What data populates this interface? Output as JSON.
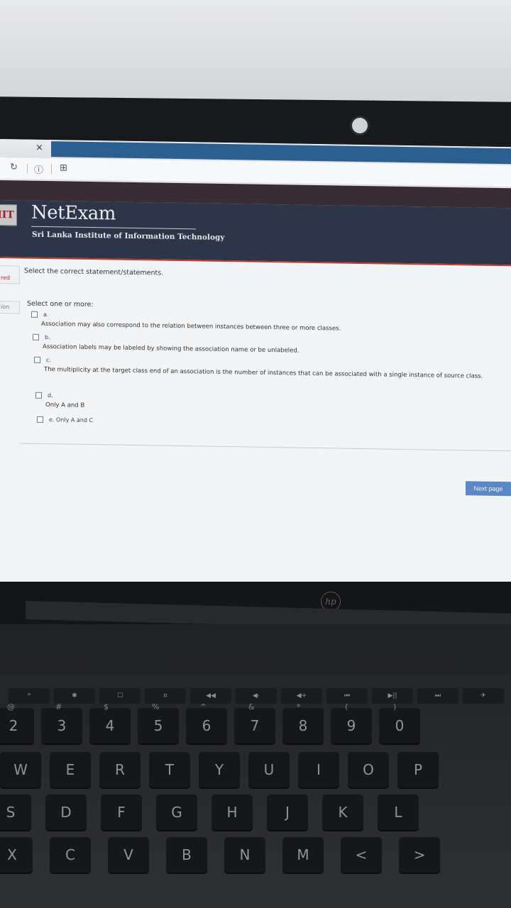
{
  "browser": {
    "tab_close": "×",
    "icons": [
      "reload-icon",
      "info-icon",
      "page-icon"
    ]
  },
  "header": {
    "logo_text": "IIT",
    "brand": "NetExam",
    "subtitle": "Sri Lanka Institute of Information Technology"
  },
  "sidebar": {
    "label_1": "red",
    "label_2": "ion"
  },
  "question": {
    "prompt": "Select the correct statement/statements.",
    "hint": "Select one or more:",
    "options": [
      {
        "letter": "a.",
        "text": "Association may also correspond to the relation between instances between three or more classes."
      },
      {
        "letter": "b.",
        "text": "Association labels may be labeled by showing the association name or be unlabeled."
      },
      {
        "letter": "c.",
        "text": "The multiplicity at the target class end of an association is the number of instances that can be associated with a single instance of source class."
      },
      {
        "letter": "d.",
        "text": "Only A and B"
      },
      {
        "letter": "e. Only A and C",
        "text": ""
      }
    ]
  },
  "actions": {
    "next_page": "Next page"
  },
  "device": {
    "brand_logo": "hp"
  },
  "keyboard": {
    "function_row": [
      "*",
      "✱",
      "☐",
      "¤",
      "◀◀",
      "◀-",
      "◀+",
      "⏮",
      "▶||",
      "⏭",
      "✈"
    ],
    "number_row": [
      "2",
      "3",
      "4",
      "5",
      "6",
      "7",
      "8",
      "9",
      "0"
    ],
    "number_row_shift": [
      "@",
      "#",
      "$",
      "%",
      "^",
      "&",
      "*",
      "(",
      ")"
    ],
    "top_row": [
      "W",
      "E",
      "R",
      "T",
      "Y",
      "U",
      "I",
      "O",
      "P"
    ],
    "home_row": [
      "S",
      "D",
      "F",
      "G",
      "H",
      "J",
      "K",
      "L"
    ],
    "bottom_row": [
      "X",
      "C",
      "V",
      "B",
      "N",
      "M",
      "<",
      ">"
    ]
  }
}
